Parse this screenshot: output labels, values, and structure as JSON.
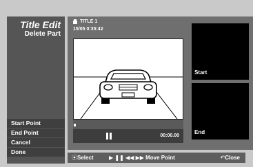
{
  "left": {
    "title": "Title Edit",
    "subtitle": "Delete Part",
    "menu": [
      "Start Point",
      "End Point",
      "Cancel",
      "Done"
    ]
  },
  "preview": {
    "title": "TITLE 1",
    "datetime": "15/05  0:35:42",
    "time": "00:00.00"
  },
  "thumbs": {
    "start": "Start",
    "end": "End"
  },
  "footer": {
    "select": "Select",
    "move": "Move Point",
    "close": "Close"
  },
  "icons": {
    "select": "select-icon",
    "play": "play-icon",
    "pause": "pause-icon",
    "rewind": "rewind-icon",
    "forward": "forward-icon",
    "return": "return-icon",
    "title": "title-icon",
    "playback_state": "pause-icon"
  },
  "colors": {
    "background": "#c9c9c9",
    "panel_dark": "#3f3f3f",
    "panel_mid": "#6f6f6f"
  }
}
